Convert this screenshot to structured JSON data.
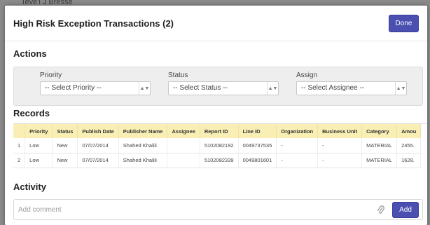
{
  "backdrop": {
    "partial_text": "Teve'l J Bresse"
  },
  "modal": {
    "title": "High Risk Exception Transactions (2)",
    "done_label": "Done"
  },
  "actions": {
    "section_title": "Actions",
    "priority": {
      "label": "Priority",
      "value": "-- Select Priority --"
    },
    "status": {
      "label": "Status",
      "value": "-- Select Status --"
    },
    "assign": {
      "label": "Assign",
      "value": "-- Select Assignee --"
    }
  },
  "records": {
    "section_title": "Records",
    "columns": [
      "",
      "Priority",
      "Status",
      "Publish Date",
      "Publisher Name",
      "Assignee",
      "Report ID",
      "Line ID",
      "Organization",
      "Business Unit",
      "Category",
      "Amou"
    ],
    "rows": [
      [
        "1",
        "Low",
        "New",
        "07/07/2014",
        "Shahed Khalili",
        "",
        "5102082192",
        "0049737535",
        "-",
        "-",
        "MATERIAL",
        "2455."
      ],
      [
        "2",
        "Low",
        "New",
        "07/07/2014",
        "Shahed Khalili",
        "",
        "5102082339",
        "0049801601",
        "-",
        "-",
        "MATERIAL",
        "1628."
      ]
    ]
  },
  "activity": {
    "section_title": "Activity",
    "comment_placeholder": "Add comment",
    "add_label": "Add"
  },
  "colors": {
    "primary_button": "#4a4fb0",
    "table_header": "#f9efb5",
    "filter_panel": "#eeeeee"
  },
  "icons": {
    "select_caret": "chevron-updown-icon",
    "attach": "paperclip-icon"
  }
}
